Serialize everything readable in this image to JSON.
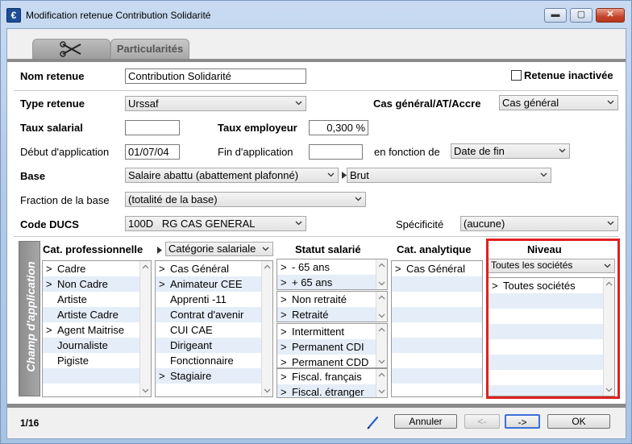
{
  "window": {
    "title": "Modification retenue Contribution Solidarité",
    "icon": "€"
  },
  "window_buttons": {
    "minimize": "▬",
    "maximize": "▢",
    "close": "✕"
  },
  "tabs": {
    "particularites": "Particularités"
  },
  "form": {
    "nom_label": "Nom retenue",
    "nom_value": "Contribution Solidarité",
    "inactive_label": "Retenue inactivée",
    "type_label": "Type retenue",
    "type_value": "Urssaf",
    "cas_label": "Cas général/AT/Accre",
    "cas_value": "Cas général",
    "taux_sal_label": "Taux salarial",
    "taux_sal_value": "",
    "taux_emp_label": "Taux employeur",
    "taux_emp_value": "0,300 %",
    "debut_label": "Début d'application",
    "debut_value": "01/07/04",
    "fin_label": "Fin d'application",
    "fin_value": "",
    "fonction_label": "en fonction de",
    "fonction_value": "Date de fin",
    "base_label": "Base",
    "base_value": "Salaire abattu (abattement plafonné)",
    "base_sub_value": "Brut",
    "fraction_label": "Fraction de la base",
    "fraction_value": "(totalité de la base)",
    "ducs_label": "Code DUCS",
    "ducs_value": "100D   RG CAS GENERAL",
    "specificite_label": "Spécificité",
    "specificite_value": "(aucune)"
  },
  "champ": {
    "side_label": "Champ d'application",
    "cat_pro_header": "Cat. professionnelle",
    "cat_sal_dropdown": "Catégorie salariale",
    "statut_header": "Statut salarié",
    "cat_ana_header": "Cat. analytique",
    "niveau_header": "Niveau",
    "niveau_dropdown": "Toutes les sociétés",
    "cat_pro_items": [
      {
        "mark": ">",
        "label": "Cadre"
      },
      {
        "mark": ">",
        "label": "Non Cadre"
      },
      {
        "mark": "",
        "label": "Artiste"
      },
      {
        "mark": "",
        "label": "Artiste Cadre"
      },
      {
        "mark": ">",
        "label": "Agent Maitrise"
      },
      {
        "mark": "",
        "label": "Journaliste"
      },
      {
        "mark": "",
        "label": "Pigiste"
      }
    ],
    "cat_sal_items": [
      {
        "mark": ">",
        "label": "Cas Général"
      },
      {
        "mark": ">",
        "label": "Animateur CEE"
      },
      {
        "mark": "",
        "label": "Apprenti -11"
      },
      {
        "mark": "",
        "label": "Contrat d'avenir"
      },
      {
        "mark": "",
        "label": "CUI CAE"
      },
      {
        "mark": "",
        "label": "Dirigeant"
      },
      {
        "mark": "",
        "label": "Fonctionnaire"
      },
      {
        "mark": ">",
        "label": "Stagiaire"
      }
    ],
    "statut_age": [
      {
        "mark": ">",
        "label": "- 65 ans"
      },
      {
        "mark": ">",
        "label": "+ 65 ans"
      }
    ],
    "statut_retraite": [
      {
        "mark": ">",
        "label": "Non retraité"
      },
      {
        "mark": ">",
        "label": "Retraité"
      }
    ],
    "statut_contrat": [
      {
        "mark": ">",
        "label": "Intermittent"
      },
      {
        "mark": ">",
        "label": "Permanent CDI"
      },
      {
        "mark": ">",
        "label": "Permanent CDD"
      }
    ],
    "statut_fiscal": [
      {
        "mark": ">",
        "label": "Fiscal. français"
      },
      {
        "mark": ">",
        "label": "Fiscal. étranger"
      }
    ],
    "cat_ana_items": [
      {
        "mark": ">",
        "label": "Cas Général"
      }
    ],
    "niveau_items": [
      {
        "mark": ">",
        "label": "Toutes sociétés"
      }
    ]
  },
  "footer": {
    "page": "1/16",
    "annuler": "Annuler",
    "prev": "<-",
    "next": "->",
    "ok": "OK"
  }
}
